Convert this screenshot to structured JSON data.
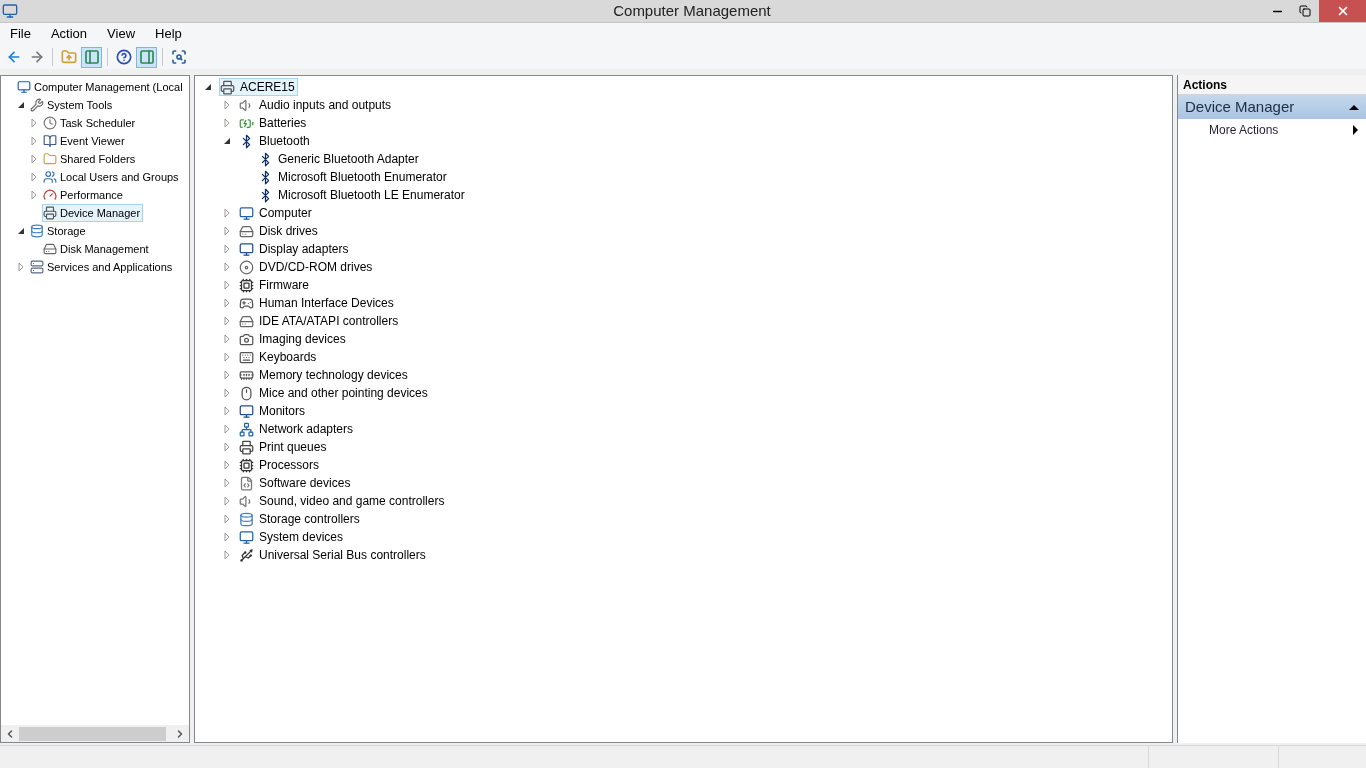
{
  "window": {
    "title": "Computer Management"
  },
  "menu": [
    "File",
    "Action",
    "View",
    "Help"
  ],
  "toolbar": [
    {
      "kind": "back",
      "selected": false
    },
    {
      "kind": "forward",
      "selected": false
    },
    {
      "kind": "up",
      "selected": false
    },
    {
      "kind": "pane",
      "selected": true
    },
    {
      "kind": "help",
      "selected": false
    },
    {
      "kind": "pane2",
      "selected": true
    },
    {
      "kind": "scan",
      "selected": false
    }
  ],
  "nav_tree": [
    {
      "label": "Computer Management (Local",
      "kind": "computer",
      "selected": false,
      "children": [
        {
          "label": "System Tools",
          "kind": "tools",
          "expanded": true,
          "selected": false,
          "children": [
            {
              "label": "Task Scheduler",
              "kind": "clock",
              "expanded": false,
              "selected": false
            },
            {
              "label": "Event Viewer",
              "kind": "log",
              "expanded": false,
              "selected": false
            },
            {
              "label": "Shared Folders",
              "kind": "folder",
              "expanded": false,
              "selected": false
            },
            {
              "label": "Local Users and Groups",
              "kind": "users",
              "expanded": false,
              "selected": false
            },
            {
              "label": "Performance",
              "kind": "gauge",
              "expanded": false,
              "selected": false
            },
            {
              "label": "Device Manager",
              "kind": "device",
              "selected": true
            }
          ]
        },
        {
          "label": "Storage",
          "kind": "storage",
          "expanded": true,
          "selected": false,
          "children": [
            {
              "label": "Disk Management",
              "kind": "disk",
              "selected": false
            }
          ]
        },
        {
          "label": "Services and Applications",
          "kind": "services",
          "expanded": false,
          "selected": false
        }
      ]
    }
  ],
  "device_tree": [
    {
      "label": "ACERE15",
      "kind": "device",
      "expanded": true,
      "selected": true,
      "children": [
        {
          "label": "Audio inputs and outputs",
          "kind": "audio",
          "expanded": false,
          "selected": false
        },
        {
          "label": "Batteries",
          "kind": "battery",
          "expanded": false,
          "selected": false
        },
        {
          "label": "Bluetooth",
          "kind": "bluetooth",
          "expanded": true,
          "selected": false,
          "children": [
            {
              "label": "Generic Bluetooth Adapter",
              "kind": "bluetooth",
              "selected": false
            },
            {
              "label": "Microsoft Bluetooth Enumerator",
              "kind": "bluetooth",
              "selected": false
            },
            {
              "label": "Microsoft Bluetooth LE Enumerator",
              "kind": "bluetooth",
              "selected": false
            }
          ]
        },
        {
          "label": "Computer",
          "kind": "computer",
          "expanded": false,
          "selected": false
        },
        {
          "label": "Disk drives",
          "kind": "disk",
          "expanded": false,
          "selected": false
        },
        {
          "label": "Display adapters",
          "kind": "monitor",
          "expanded": false,
          "selected": false
        },
        {
          "label": "DVD/CD-ROM drives",
          "kind": "dvd",
          "expanded": false,
          "selected": false
        },
        {
          "label": "Firmware",
          "kind": "chip",
          "expanded": false,
          "selected": false
        },
        {
          "label": "Human Interface Devices",
          "kind": "hid",
          "expanded": false,
          "selected": false
        },
        {
          "label": "IDE ATA/ATAPI controllers",
          "kind": "disk",
          "expanded": false,
          "selected": false
        },
        {
          "label": "Imaging devices",
          "kind": "camera",
          "expanded": false,
          "selected": false
        },
        {
          "label": "Keyboards",
          "kind": "keyboard",
          "expanded": false,
          "selected": false
        },
        {
          "label": "Memory technology devices",
          "kind": "memory",
          "expanded": false,
          "selected": false
        },
        {
          "label": "Mice and other pointing devices",
          "kind": "mouse",
          "expanded": false,
          "selected": false
        },
        {
          "label": "Monitors",
          "kind": "monitor",
          "expanded": false,
          "selected": false
        },
        {
          "label": "Network adapters",
          "kind": "network",
          "expanded": false,
          "selected": false
        },
        {
          "label": "Print queues",
          "kind": "printer",
          "expanded": false,
          "selected": false
        },
        {
          "label": "Processors",
          "kind": "chip",
          "expanded": false,
          "selected": false
        },
        {
          "label": "Software devices",
          "kind": "software",
          "expanded": false,
          "selected": false
        },
        {
          "label": "Sound, video and game controllers",
          "kind": "audio",
          "expanded": false,
          "selected": false
        },
        {
          "label": "Storage controllers",
          "kind": "storage",
          "expanded": false,
          "selected": false
        },
        {
          "label": "System devices",
          "kind": "computer",
          "expanded": false,
          "selected": false
        },
        {
          "label": "Universal Serial Bus controllers",
          "kind": "usb",
          "expanded": false,
          "selected": false
        }
      ]
    }
  ],
  "actions": {
    "header": "Actions",
    "section": {
      "title": "Device Manager",
      "expanded": true
    },
    "items": [
      "More Actions"
    ]
  }
}
